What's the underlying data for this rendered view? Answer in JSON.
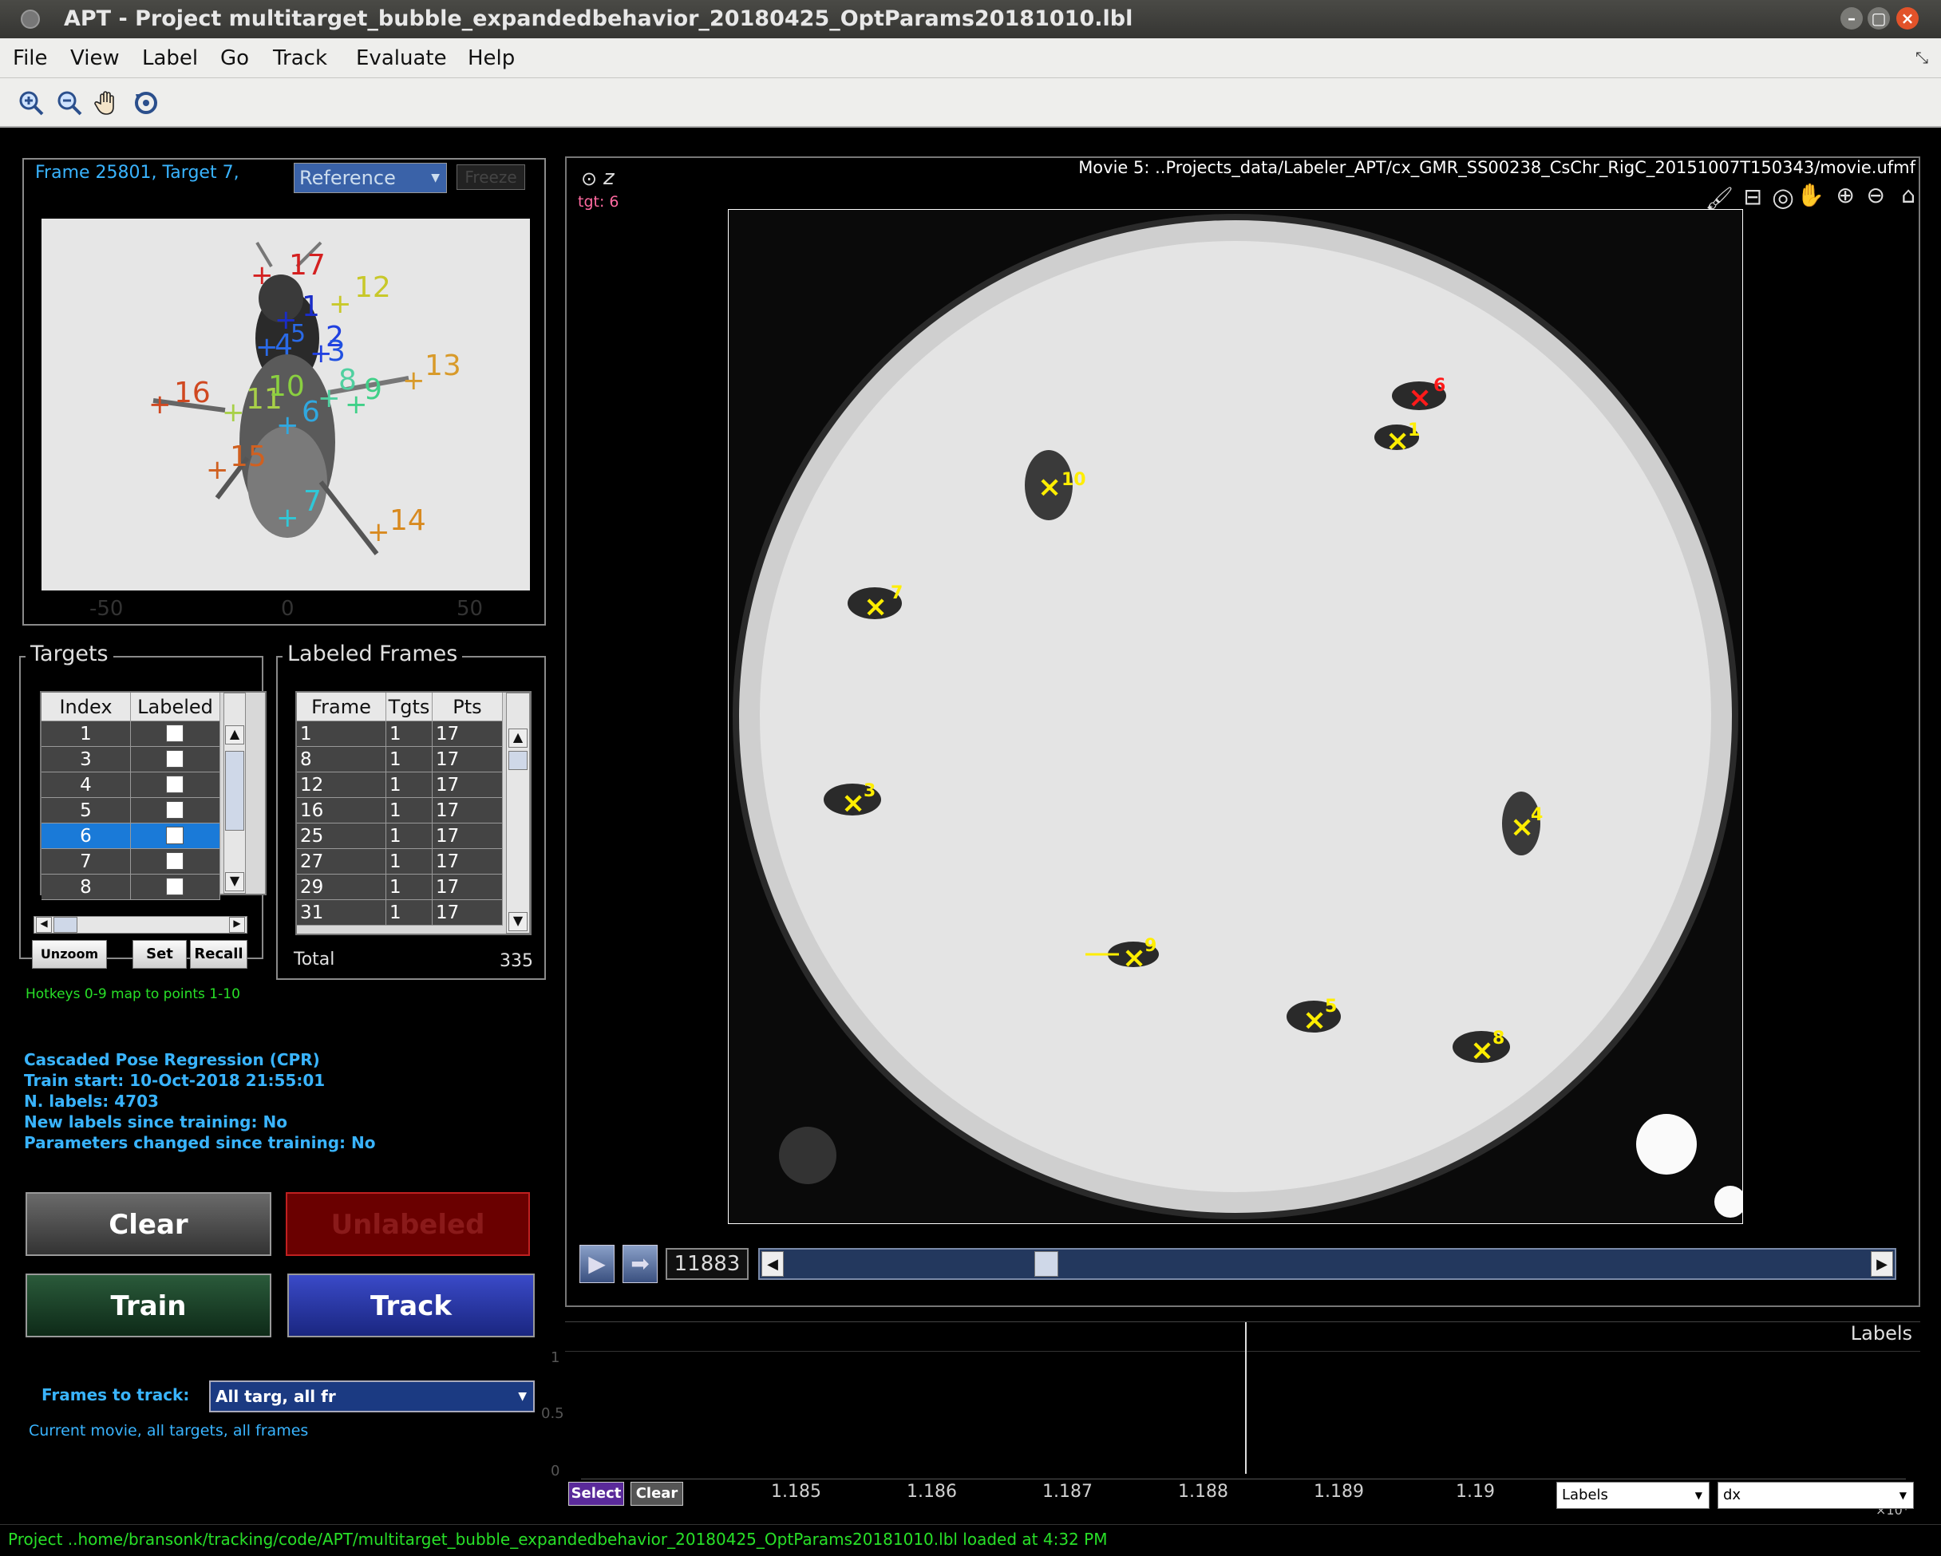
{
  "window": {
    "title": "APT - Project multitarget_bubble_expandedbehavior_20180425_OptParams20181010.lbl"
  },
  "menu": [
    "File",
    "View",
    "Label",
    "Go",
    "Track",
    "Evaluate",
    "Help"
  ],
  "toolbar": {
    "icons": [
      "zoom-in-icon",
      "zoom-out-icon",
      "pan-hand-icon",
      "rotate-icon"
    ]
  },
  "zoom_panel": {
    "frame_info": "Frame 25801, Target 7,",
    "reference_select": "Reference",
    "freeze_button": "Freeze",
    "x_ticks": [
      "-50",
      "0",
      "50"
    ],
    "landmarks": [
      {
        "label": "17",
        "color": "#d42020"
      },
      {
        "label": "1",
        "color": "#1a2dc8"
      },
      {
        "label": "12",
        "color": "#c8c82a"
      },
      {
        "label": "2",
        "color": "#2040e0"
      },
      {
        "label": "3",
        "color": "#2050e0"
      },
      {
        "label": "4",
        "color": "#2a6ae8"
      },
      {
        "label": "5",
        "color": "#2a6ae8"
      },
      {
        "label": "13",
        "color": "#d89a2a"
      },
      {
        "label": "16",
        "color": "#d04820"
      },
      {
        "label": "11",
        "color": "#a8d048"
      },
      {
        "label": "10",
        "color": "#8ad040"
      },
      {
        "label": "8",
        "color": "#50d0a0"
      },
      {
        "label": "9",
        "color": "#40d088"
      },
      {
        "label": "6",
        "color": "#30a8e0"
      },
      {
        "label": "15",
        "color": "#d06020"
      },
      {
        "label": "7",
        "color": "#30c8d8"
      },
      {
        "label": "14",
        "color": "#d88a20"
      }
    ]
  },
  "targets": {
    "title": "Targets",
    "headers": [
      "Index",
      "Labeled"
    ],
    "rows": [
      {
        "index": "1",
        "labeled": false
      },
      {
        "index": "3",
        "labeled": false
      },
      {
        "index": "4",
        "labeled": false
      },
      {
        "index": "5",
        "labeled": false
      },
      {
        "index": "6",
        "labeled": false,
        "selected": true
      },
      {
        "index": "7",
        "labeled": false
      },
      {
        "index": "8",
        "labeled": false
      }
    ],
    "buttons": {
      "unzoom": "Unzoom",
      "set": "Set",
      "recall": "Recall"
    }
  },
  "labeled_frames": {
    "title": "Labeled Frames",
    "headers": [
      "Frame",
      "Tgts",
      "Pts"
    ],
    "rows": [
      [
        "1",
        "1",
        "17"
      ],
      [
        "8",
        "1",
        "17"
      ],
      [
        "12",
        "1",
        "17"
      ],
      [
        "16",
        "1",
        "17"
      ],
      [
        "25",
        "1",
        "17"
      ],
      [
        "27",
        "1",
        "17"
      ],
      [
        "29",
        "1",
        "17"
      ],
      [
        "31",
        "1",
        "17"
      ]
    ],
    "total_label": "Total",
    "total_value": "335"
  },
  "hotkeys_hint": "Hotkeys 0-9 map to points 1-10",
  "tracker_info": {
    "line1": "Cascaded Pose Regression (CPR)",
    "line2": "Train start: 10-Oct-2018 21:55:01",
    "line3": "N. labels: 4703",
    "line4": "New labels since training: No",
    "line5": "Parameters changed since training: No"
  },
  "actions": {
    "clear": "Clear",
    "unlabeled": "Unlabeled",
    "train": "Train",
    "track": "Track"
  },
  "frames_to_track": {
    "label": "Frames to track:",
    "value": "All targ, all fr",
    "description": "Current movie, all targets, all frames"
  },
  "main_view": {
    "movie_title": "Movie 5: ..Projects_data/Labeler_APT/cx_GMR_SS00238_CsChr_RigC_20151007T150343/movie.ufmf",
    "z_label": "z",
    "tgt_label": "tgt: 6",
    "flies": [
      {
        "label": "6",
        "selected": true
      },
      {
        "label": "1"
      },
      {
        "label": "10"
      },
      {
        "label": "7"
      },
      {
        "label": "3"
      },
      {
        "label": "4"
      },
      {
        "label": "9"
      },
      {
        "label": "5"
      },
      {
        "label": "8"
      }
    ]
  },
  "playback": {
    "frame_number": "11883",
    "slider_position": 0.235
  },
  "timeline": {
    "title": "Labels",
    "y_ticks": [
      "1",
      "0.5",
      "0"
    ],
    "x_ticks": [
      "1.185",
      "1.186",
      "1.187",
      "1.188",
      "1.189",
      "1.19"
    ],
    "x_exponent": "×10⁴",
    "select_button": "Select",
    "clear_button": "Clear",
    "labels_dropdown": "Labels",
    "dx_dropdown": "dx"
  },
  "status": "Project ..home/bransonk/tracking/code/APT/multitarget_bubble_expandedbehavior_20180425_OptParams20181010.lbl loaded at  4:32 PM"
}
